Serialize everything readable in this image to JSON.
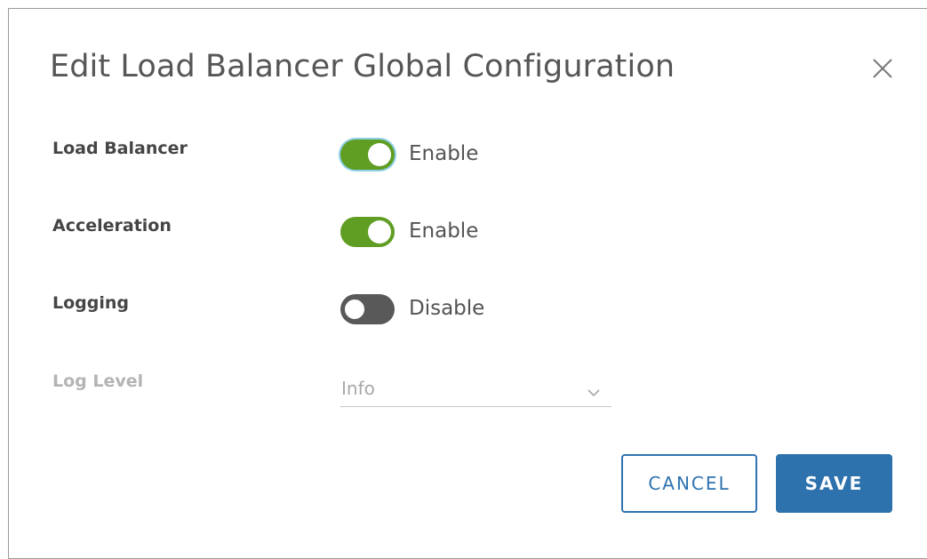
{
  "dialog": {
    "title": "Edit Load Balancer Global Configuration",
    "close_icon": "close-icon"
  },
  "settings": [
    {
      "label": "Load Balancer",
      "state": "on",
      "state_text": "Enable",
      "focused": true
    },
    {
      "label": "Acceleration",
      "state": "on",
      "state_text": "Enable",
      "focused": false
    },
    {
      "label": "Logging",
      "state": "off",
      "state_text": "Disable",
      "focused": false
    }
  ],
  "log_level": {
    "label": "Log Level",
    "value": "Info",
    "disabled": true,
    "chevron_icon": "chevron-down-icon"
  },
  "buttons": {
    "cancel_label": "CANCEL",
    "save_label": "SAVE"
  },
  "colors": {
    "toggle_on": "#5f9d23",
    "toggle_off": "#595959",
    "primary": "#2e72ad"
  }
}
